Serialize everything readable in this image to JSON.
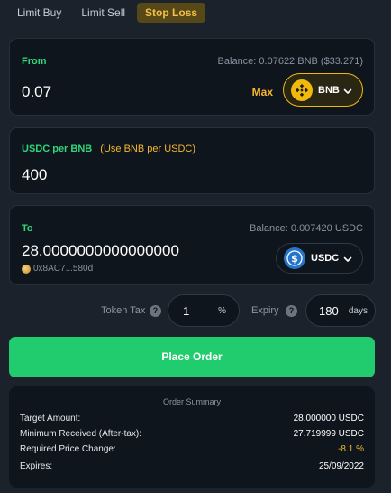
{
  "tabs": [
    {
      "label": "Limit Buy",
      "active": false
    },
    {
      "label": "Limit Sell",
      "active": false
    },
    {
      "label": "Stop Loss",
      "active": true
    }
  ],
  "from": {
    "label": "From",
    "balance": "Balance: 0.07622 BNB ($33.271)",
    "amount": "0.07",
    "max_label": "Max",
    "token": {
      "symbol": "BNB",
      "icon": "bnb-coin-icon",
      "color": "#f0b90b"
    }
  },
  "rate": {
    "label": "USDC per BNB",
    "toggle": "(Use BNB per USDC)",
    "value": "400"
  },
  "to": {
    "label": "To",
    "balance": "Balance: 0.007420 USDC",
    "amount": "28.0000000000000000",
    "address": "0x8AC7...580d",
    "token": {
      "symbol": "USDC",
      "icon": "usdc-coin-icon",
      "color": "#2775ca"
    }
  },
  "params": {
    "tax_label": "Token Tax",
    "tax_value": "1",
    "tax_unit": "%",
    "expiry_label": "Expiry",
    "expiry_value": "180",
    "expiry_unit": "days"
  },
  "place_order": "Place Order",
  "summary": {
    "title": "Order Summary",
    "rows": [
      {
        "key": "Target Amount:",
        "value": "28.000000 USDC"
      },
      {
        "key": "Minimum Received (After-tax):",
        "value": "27.719999 USDC"
      },
      {
        "key": "Required Price Change:",
        "value": "-8.1 %"
      },
      {
        "key": "Expires:",
        "value": "25/09/2022"
      }
    ]
  },
  "colors": {
    "accent_green": "#20cc6d",
    "accent_orange": "#f5b731",
    "background": "#1b222b",
    "card": "#0f151c"
  }
}
